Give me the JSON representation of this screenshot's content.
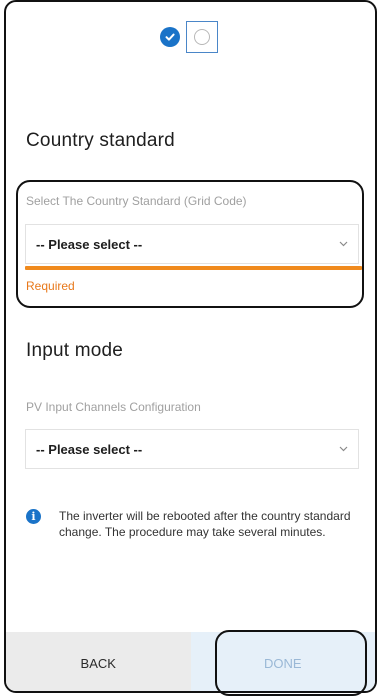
{
  "stepper": {
    "step1_icon": "check-circle-icon",
    "step2_icon": "empty-circle-icon"
  },
  "country": {
    "title": "Country standard",
    "label": "Select The Country Standard (Grid Code)",
    "value": "-- Please select --",
    "error": "Required"
  },
  "input_mode": {
    "title": "Input mode",
    "label": "PV Input Channels Configuration",
    "value": "-- Please select --"
  },
  "info": {
    "icon": "info-icon",
    "text": "The inverter will be rebooted after the country standard change. The procedure may take several minutes."
  },
  "footer": {
    "back_label": "BACK",
    "done_label": "DONE"
  },
  "colors": {
    "accent": "#1a73c8",
    "error": "#f08a1d",
    "done_bg": "#e6f0f9"
  }
}
